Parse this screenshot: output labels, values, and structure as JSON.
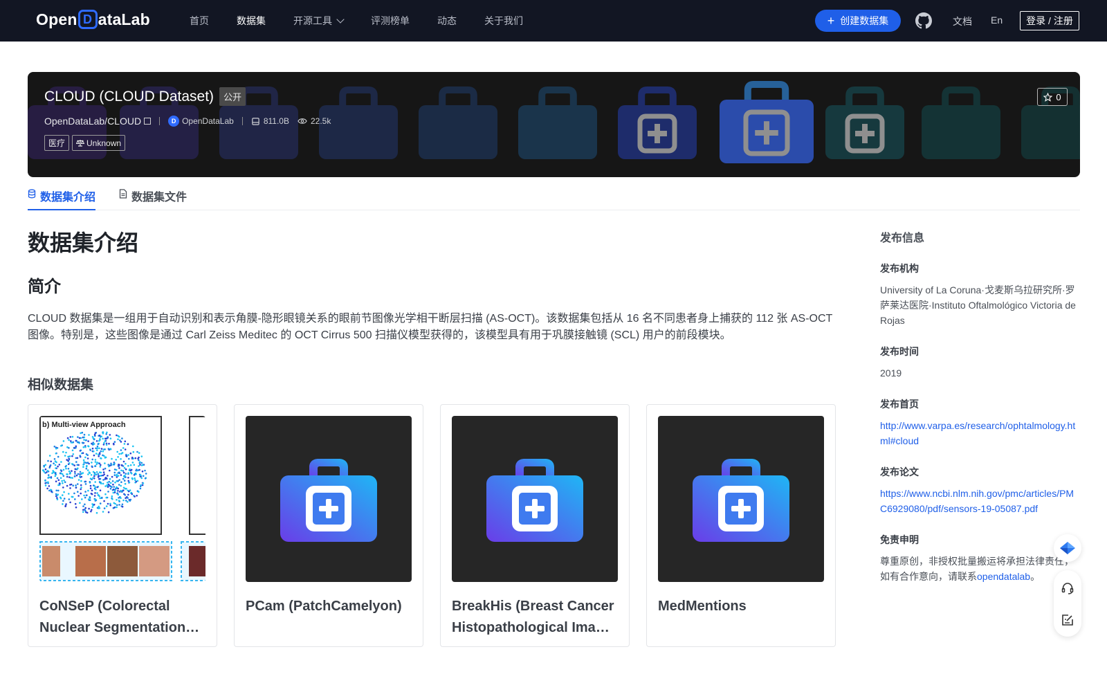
{
  "nav": {
    "logo_left": "Open",
    "logo_mark": "D",
    "logo_right": "ataLab",
    "items": [
      {
        "label": "首页",
        "active": false
      },
      {
        "label": "数据集",
        "active": true
      },
      {
        "label": "开源工具",
        "active": false,
        "dropdown": true
      },
      {
        "label": "评测榜单",
        "active": false
      },
      {
        "label": "动态",
        "active": false
      },
      {
        "label": "关于我们",
        "active": false
      }
    ],
    "create_button": "创建数据集",
    "docs": "文档",
    "lang": "En",
    "login": "登录 / 注册"
  },
  "banner": {
    "title": "CLOUD (CLOUD Dataset)",
    "visibility": "公开",
    "repo": "OpenDataLab/CLOUD",
    "org": "OpenDataLab",
    "size": "811.0B",
    "views": "22.5k",
    "tags": [
      "医疗",
      "Unknown"
    ],
    "stars": "0"
  },
  "tabs": [
    {
      "label": "数据集介绍",
      "active": true,
      "icon": "database-icon"
    },
    {
      "label": "数据集文件",
      "active": false,
      "icon": "file-icon"
    }
  ],
  "main": {
    "heading": "数据集介绍",
    "intro_heading": "简介",
    "description": "CLOUD 数据集是一组用于自动识别和表示角膜-隐形眼镜关系的眼前节图像光学相干断层扫描 (AS-OCT)。该数据集包括从 16 名不同患者身上捕获的 112 张 AS-OCT 图像。特别是，这些图像是通过 Carl Zeiss Meditec 的 OCT Cirrus 500 扫描仪模型获得的，该模型具有用于巩膜接触镜 (SCL) 用户的前段模块。",
    "similar_heading": "相似数据集",
    "similar": [
      {
        "title": "CoNSeP (Colorectal Nuclear Segmentation and Phenotypes)",
        "thumb": "figure",
        "figure_label": "b) Multi-view Approach"
      },
      {
        "title": "PCam (PatchCamelyon)",
        "thumb": "medical-kit-icon"
      },
      {
        "title": "BreakHis (Breast Cancer Histopathological Image Classification)",
        "thumb": "medical-kit-icon"
      },
      {
        "title": "MedMentions",
        "thumb": "medical-kit-icon"
      }
    ]
  },
  "sidebar": {
    "heading": "发布信息",
    "org_label": "发布机构",
    "org_value": "University of La Coruna·戈麦斯乌拉研究所·罗萨莱达医院·Instituto Oftalmológico Victoria de Rojas",
    "time_label": "发布时间",
    "time_value": "2019",
    "home_label": "发布首页",
    "home_value": "http://www.varpa.es/research/ophtalmology.html#cloud",
    "paper_label": "发布论文",
    "paper_value": "https://www.ncbi.nlm.nih.gov/pmc/articles/PMC6929080/pdf/sensors-19-05087.pdf",
    "disclaimer_label": "免责申明",
    "disclaimer_text": "尊重原创，非授权批量搬运将承担法律责任，如有合作意向，请联系",
    "disclaimer_link": "opendatalab",
    "disclaimer_end": "。"
  },
  "colors": {
    "accent": "#1f5fe8",
    "nav_bg": "#121623",
    "banner_bg": "#161616"
  }
}
